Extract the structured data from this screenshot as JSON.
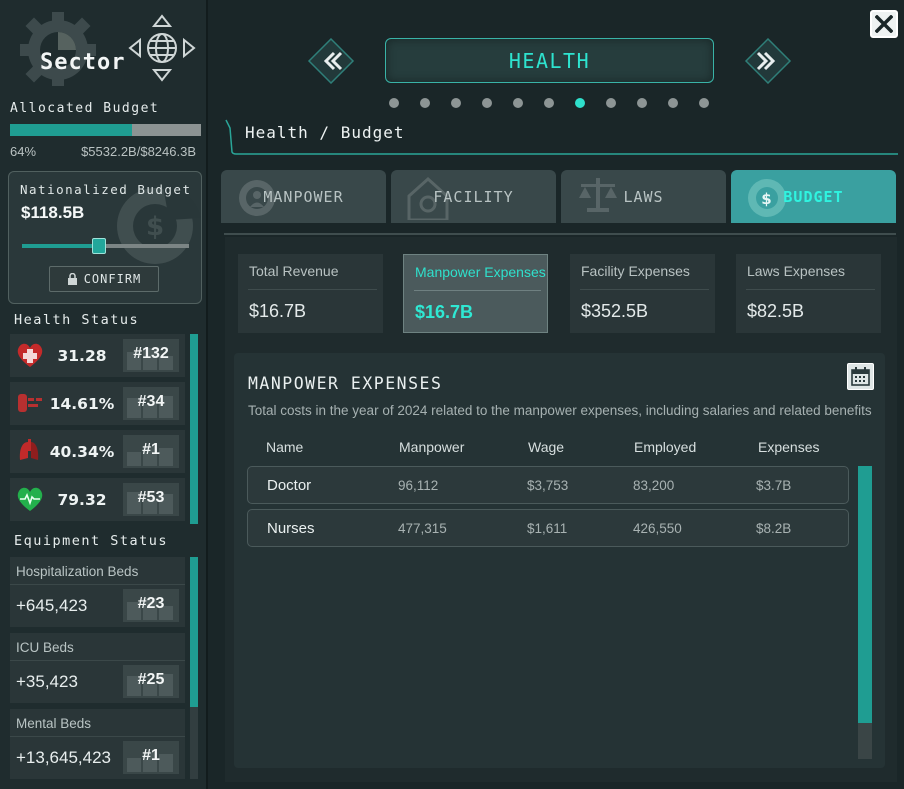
{
  "sidebar": {
    "title": "Sector",
    "allocated": {
      "label": "Allocated Budget",
      "percent_text": "64%",
      "fraction": 0.64,
      "amount_text": "$5532.2B/$8246.3B"
    },
    "nationalized": {
      "label": "Nationalized Budget",
      "value": "$118.5B",
      "slider_fraction": 0.46,
      "confirm_label": "CONFIRM"
    },
    "health_status_label": "Health Status",
    "health_status": [
      {
        "icon": "heart-cross-icon",
        "value": "31.28",
        "rank": "#132"
      },
      {
        "icon": "pill-icon",
        "value": "14.61%",
        "rank": "#34"
      },
      {
        "icon": "lungs-icon",
        "value": "40.34%",
        "rank": "#1"
      },
      {
        "icon": "heart-pulse-icon",
        "value": "79.32",
        "rank": "#53"
      }
    ],
    "equipment_status_label": "Equipment Status",
    "equipment_status": [
      {
        "name": "Hospitalization Beds",
        "value": "+645,423",
        "rank": "#23"
      },
      {
        "name": "ICU Beds",
        "value": "+35,423",
        "rank": "#25"
      },
      {
        "name": "Mental Beds",
        "value": "+13,645,423",
        "rank": "#1"
      }
    ]
  },
  "header": {
    "sector_name": "HEALTH",
    "page_count": 11,
    "active_page": 7,
    "breadcrumb": "Health / Budget"
  },
  "tabs": [
    {
      "label": "MANPOWER",
      "icon": "gear-person-icon",
      "active": false
    },
    {
      "label": "FACILITY",
      "icon": "house-gear-icon",
      "active": false
    },
    {
      "label": "LAWS",
      "icon": "scales-icon",
      "active": false
    },
    {
      "label": "BUDGET",
      "icon": "coin-icon",
      "active": true
    }
  ],
  "summary_cards": [
    {
      "label": "Total Revenue",
      "value": "$16.7B",
      "active": false
    },
    {
      "label": "Manpower Expenses",
      "value": "$16.7B",
      "active": true
    },
    {
      "label": "Facility Expenses",
      "value": "$352.5B",
      "active": false
    },
    {
      "label": "Laws Expenses",
      "value": "$82.5B",
      "active": false
    }
  ],
  "panel": {
    "title": "MANPOWER EXPENSES",
    "description": "Total costs in the year of 2024 related to the manpower expenses, including salaries and related benefits",
    "columns": [
      "Name",
      "Manpower",
      "Wage",
      "Employed",
      "Expenses"
    ],
    "rows": [
      [
        "Doctor",
        "96,112",
        "$3,753",
        "83,200",
        "$3.7B"
      ],
      [
        "Nurses",
        "477,315",
        "$1,611",
        "426,550",
        "$8.2B"
      ]
    ]
  },
  "colors": {
    "accent": "#1f9d92",
    "accent_bright": "#2fe0cc",
    "panel_bg": "#253335",
    "sidebar_bg": "#1f2c2e"
  }
}
